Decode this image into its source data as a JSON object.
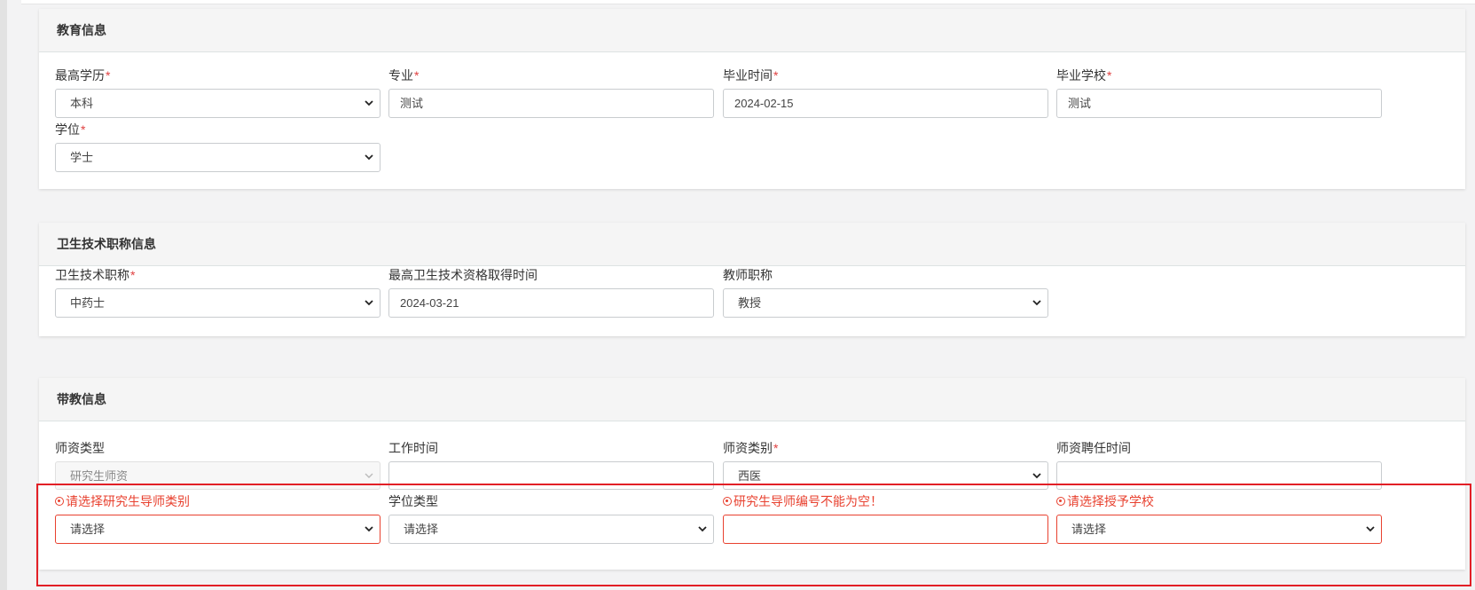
{
  "education": {
    "title": "教育信息",
    "highest_degree": {
      "label": "最高学历",
      "value": "本科"
    },
    "major": {
      "label": "专业",
      "value": "测试"
    },
    "graduation_date": {
      "label": "毕业时间",
      "value": "2024-02-15"
    },
    "school": {
      "label": "毕业学校",
      "value": "测试"
    },
    "degree": {
      "label": "学位",
      "value": "学士"
    }
  },
  "title_info": {
    "title": "卫生技术职称信息",
    "tech_title": {
      "label": "卫生技术职称",
      "value": "中药士"
    },
    "qualification_date": {
      "label": "最高卫生技术资格取得时间",
      "value": "2024-03-21"
    },
    "teacher_title": {
      "label": "教师职称",
      "value": "教授"
    }
  },
  "teaching": {
    "title": "带教信息",
    "faculty_type": {
      "label": "师资类型",
      "value": "研究生师资"
    },
    "work_time": {
      "label": "工作时间",
      "value": ""
    },
    "faculty_category": {
      "label": "师资类别",
      "value": "西医"
    },
    "appointment_time": {
      "label": "师资聘任时间",
      "value": ""
    },
    "supervisor_category": {
      "error": "请选择研究生导师类别",
      "value": "请选择"
    },
    "degree_type": {
      "label": "学位类型",
      "value": "请选择"
    },
    "supervisor_number": {
      "error": "研究生导师编号不能为空！",
      "value": ""
    },
    "granting_school": {
      "error": "请选择授予学校",
      "value": "请选择"
    }
  },
  "required_mark": "*",
  "colors": {
    "error": "#e8412f",
    "highlight": "#e21f26",
    "header_bg": "#f5f5f5"
  }
}
